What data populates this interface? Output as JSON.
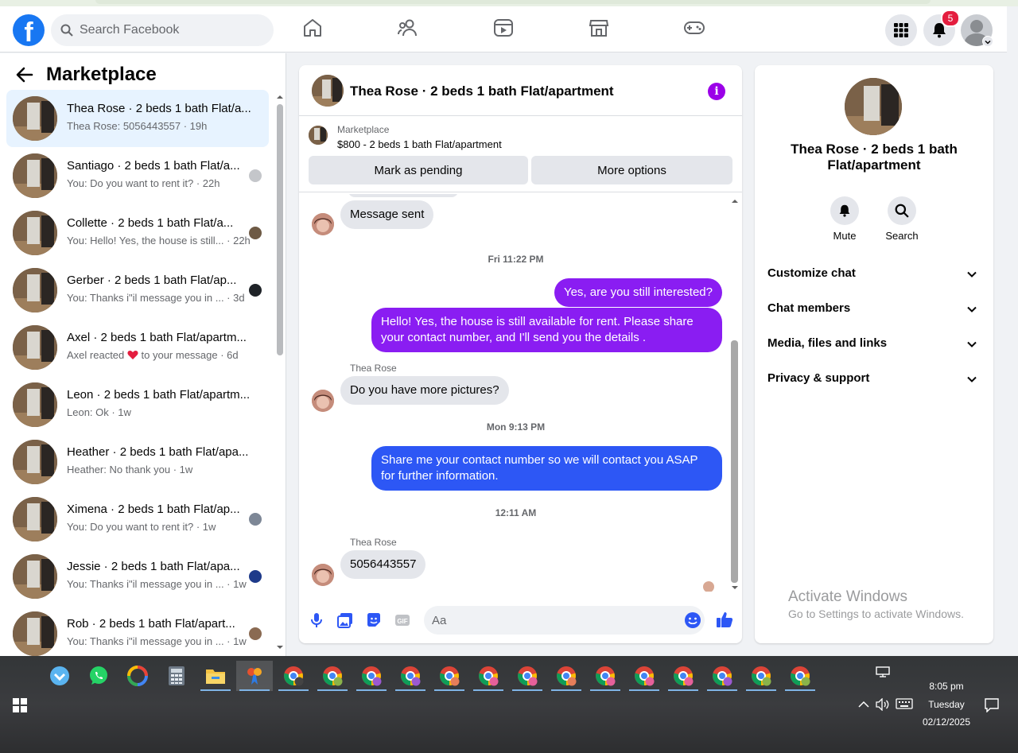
{
  "header": {
    "search_placeholder": "Search Facebook",
    "notification_count": "5"
  },
  "sidebar": {
    "title": "Marketplace",
    "conversations": [
      {
        "name": "Thea Rose · 2 beds 1 bath Flat/a...",
        "preview": "Thea Rose: 5056443557 · 19h"
      },
      {
        "name": "Santiago · 2 beds 1 bath Flat/a...",
        "preview": "You: Do you want to rent it? · 22h"
      },
      {
        "name": "Collette · 2 beds 1 bath Flat/a...",
        "preview": "You: Hello! Yes, the house is still... · 22h"
      },
      {
        "name": "Gerber · 2 beds 1 bath Flat/ap...",
        "preview": "You: Thanks i\"il message you in ... · 3d"
      },
      {
        "name": "Axel · 2 beds 1 bath Flat/apartm...",
        "preview_pre": "Axel reacted",
        "preview_post": "to your message · 6d"
      },
      {
        "name": "Leon · 2 beds 1 bath Flat/apartm...",
        "preview": "Leon: Ok · 1w"
      },
      {
        "name": "Heather · 2 beds 1 bath Flat/apa...",
        "preview": "Heather: No thank you · 1w"
      },
      {
        "name": "Ximena · 2 beds 1 bath Flat/ap...",
        "preview": "You: Do you want to rent it? · 1w"
      },
      {
        "name": "Jessie · 2 beds 1 bath Flat/apa...",
        "preview": "You: Thanks i\"il message you in ... · 1w"
      },
      {
        "name": "Rob · 2 beds 1 bath Flat/apart...",
        "preview": "You: Thanks i\"il message you in ... · 1w"
      }
    ]
  },
  "chat": {
    "title": "Thea Rose · 2 beds 1 bath Flat/apartment",
    "marketplace_label": "Marketplace",
    "listing": "$800 - 2 beds 1 bath Flat/apartment",
    "mark_pending": "Mark as pending",
    "more_options": "More options",
    "messages": {
      "m1": "Message sent",
      "ts1": "Fri 11:22 PM",
      "m2": "Yes, are you still interested?",
      "m3": "Hello! Yes, the house is still available for rent. Please share your contact number, and I'll send you the details .",
      "sender1": "Thea Rose",
      "m4": "Do you have more pictures?",
      "ts2": "Mon 9:13 PM",
      "m5": "Share me your contact number so we will contact you ASAP for further information.",
      "ts3": "12:11 AM",
      "sender2": "Thea Rose",
      "m6": "5056443557"
    },
    "composer_placeholder": "Aa"
  },
  "info_panel": {
    "name": "Thea Rose · 2 beds 1 bath Flat/apartment",
    "mute": "Mute",
    "search": "Search",
    "rows": [
      "Customize chat",
      "Chat members",
      "Media, files and links",
      "Privacy & support"
    ],
    "activate_title": "Activate Windows",
    "activate_sub": "Go to Settings to activate Windows."
  },
  "taskbar": {
    "time": "8:05 pm",
    "day": "Tuesday",
    "date": "02/12/2025"
  },
  "colors": {
    "accent_purple": "#8a1df2",
    "accent_blue": "#2d57f5",
    "fb_blue": "#1877f2"
  }
}
